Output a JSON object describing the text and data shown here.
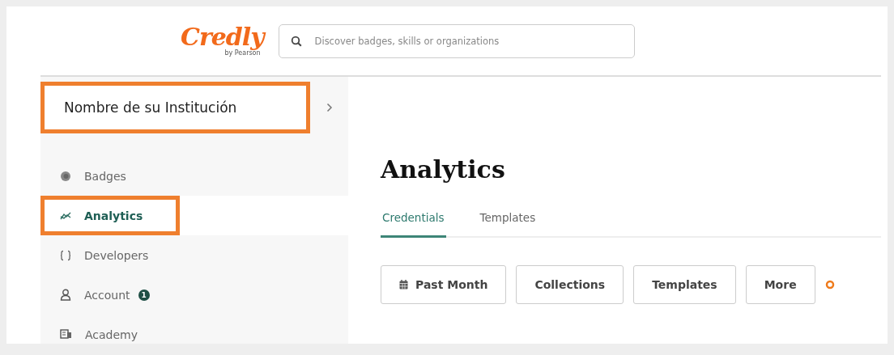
{
  "header": {
    "logo": "Credly",
    "logo_sub": "by Pearson",
    "search": {
      "placeholder": "Discover badges, skills or organizations"
    }
  },
  "sidebar": {
    "organization": {
      "name": "Nombre de su Institución",
      "highlighted": true
    },
    "items": [
      {
        "kind": "badge",
        "label": "Badges",
        "selected": false,
        "highlighted": false
      },
      {
        "kind": "chart",
        "label": "Analytics",
        "selected": true,
        "highlighted": true
      },
      {
        "kind": "braces",
        "label": "Developers",
        "selected": false,
        "highlighted": false
      },
      {
        "kind": "person",
        "label": "Account",
        "selected": false,
        "highlighted": false,
        "count": "1"
      },
      {
        "kind": "book",
        "label": "Academy",
        "selected": false,
        "highlighted": false
      }
    ]
  },
  "main": {
    "title": "Analytics",
    "tabs": [
      {
        "label": "Credentials",
        "selected": true
      },
      {
        "label": "Templates",
        "selected": false
      }
    ],
    "filters": [
      {
        "kind": "calendar",
        "label": "Past Month"
      },
      {
        "kind": "plain",
        "label": "Collections"
      },
      {
        "kind": "plain",
        "label": "Templates"
      },
      {
        "kind": "plain",
        "label": "More"
      }
    ]
  }
}
